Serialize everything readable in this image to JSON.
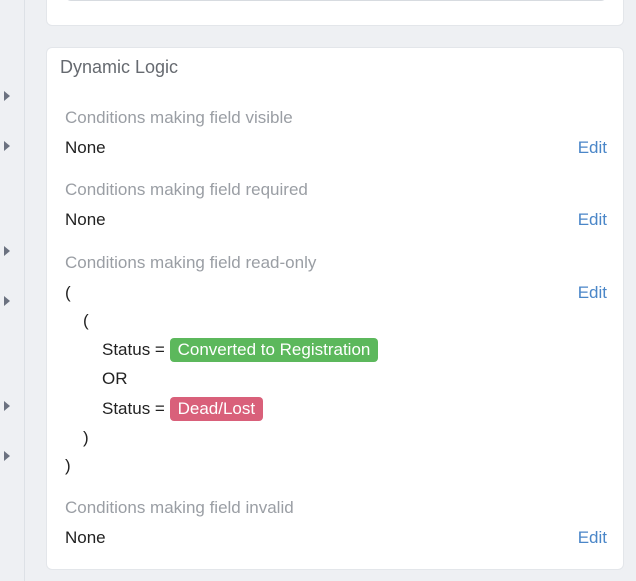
{
  "panel": {
    "title": "Dynamic Logic"
  },
  "sections": {
    "visible": {
      "label": "Conditions making field visible",
      "value": "None",
      "edit": "Edit"
    },
    "required": {
      "label": "Conditions making field required",
      "value": "None",
      "edit": "Edit"
    },
    "readonly": {
      "label": "Conditions making field read-only",
      "edit": "Edit",
      "open_outer": "(",
      "open_inner": "(",
      "cond1_field": "Status =",
      "cond1_value": "Converted to Registration",
      "operator": "OR",
      "cond2_field": "Status =",
      "cond2_value": "Dead/Lost",
      "close_inner": ")",
      "close_outer": ")"
    },
    "invalid": {
      "label": "Conditions making field invalid",
      "value": "None",
      "edit": "Edit"
    }
  },
  "colors": {
    "accent_link": "#4a86c8",
    "badge_green": "#5cb85c",
    "badge_red": "#d9607a"
  },
  "icons": {
    "side_arrows": "caret-right-icon"
  }
}
